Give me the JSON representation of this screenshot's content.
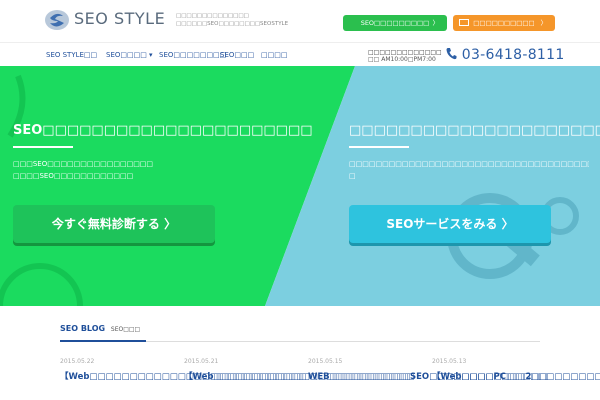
{
  "header": {
    "logo_text": "SEO STYLE",
    "tagline_line1": "□□□□□□□□□□□□□□",
    "tagline_line2": "□□□□□□SEO□□□□□□□□SEOSTYLE",
    "btn_green": "SEO□□□□□□□□□",
    "btn_orange": "□□□□□□□□□□",
    "chevron": "〉"
  },
  "nav": {
    "items": [
      "SEO STYLE□□",
      "SEO□□□□ ▾",
      "SEO□□□□□□□□",
      "SEO□□□",
      "□□□□"
    ],
    "hours_line1": "□□□□□□□□□□□□□",
    "hours_line2": "□□ AM10:00□PM7:00",
    "phone": "03-6418-8111"
  },
  "hero": {
    "left_title": "SEO□□□□□□□□□□□□□□□□□□□□□□",
    "left_text1": "□□□SEO□□□□□□□□□□□□□□□□",
    "left_text2": "□□□□SEO□□□□□□□□□□□□",
    "left_cta": "今すぐ無料診断する 〉",
    "right_title": "□□□□□□□□□□□□□□□□□□□□□",
    "right_text1": "□□□□□□□□□□□□□□□□□□□□□□□□□□□□□□□□□□□□□□□□□□□",
    "right_text2": "□",
    "right_cta": "SEOサービスをみる 〉"
  },
  "blog": {
    "heading": "SEO BLOG",
    "subheading": "SEO□□□",
    "posts": [
      {
        "date": "2015.05.22",
        "title": "【Web□□□□□□□□□□□□□□□□□□□□□□□□□□□"
      },
      {
        "date": "2015.05.21",
        "title": "【Web□□□□□□□□□□□□□□□□□□□□□□□□□"
      },
      {
        "date": "2015.05.15",
        "title": "WEB□□□□□□□□□□SEO□□□□□□□□□□□□2□□"
      },
      {
        "date": "2015.05.13",
        "title": "【Web□□□□PC□□□□□□□□□□□□□□□"
      }
    ]
  },
  "colors": {
    "hero_green": "#1bdb5f",
    "hero_blue": "#7ccfe0",
    "nav_link": "#1f4f9a",
    "btn_green": "#2bbf4e",
    "btn_orange": "#f5962a"
  }
}
